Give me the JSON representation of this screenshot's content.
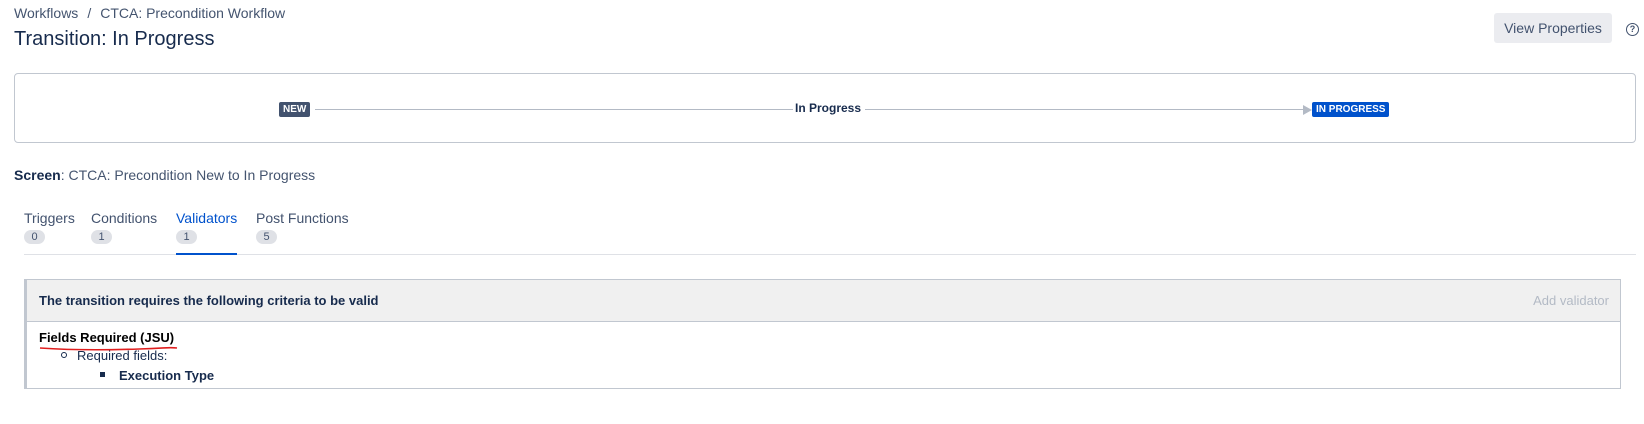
{
  "breadcrumb": {
    "items": [
      "Workflows",
      "CTCA: Precondition Workflow"
    ],
    "separator": "/"
  },
  "header": {
    "title": "Transition: In Progress",
    "view_properties_label": "View Properties",
    "help_icon": "question-circle-icon"
  },
  "diagram": {
    "from_status": "NEW",
    "transition_name": "In Progress",
    "to_status": "IN PROGRESS",
    "colors": {
      "from_status_bg": "#42526e",
      "to_status_bg": "#0052cc",
      "line": "#b3bac5"
    }
  },
  "screen": {
    "label": "Screen",
    "value": "CTCA: Precondition New to In Progress"
  },
  "tabs": [
    {
      "label": "Triggers",
      "count": "0",
      "active": false
    },
    {
      "label": "Conditions",
      "count": "1",
      "active": false
    },
    {
      "label": "Validators",
      "count": "1",
      "active": true
    },
    {
      "label": "Post Functions",
      "count": "5",
      "active": false
    }
  ],
  "validators_panel": {
    "header": "The transition requires the following criteria to be valid",
    "add_label": "Add validator",
    "validator": {
      "name": "Fields Required (JSU)",
      "sub_label": "Required fields:",
      "fields": [
        "Execution Type"
      ]
    },
    "annotation_color": "#e01e1e"
  },
  "colors": {
    "accent": "#0052cc",
    "text": "#172b4d",
    "muted": "#44546f"
  }
}
